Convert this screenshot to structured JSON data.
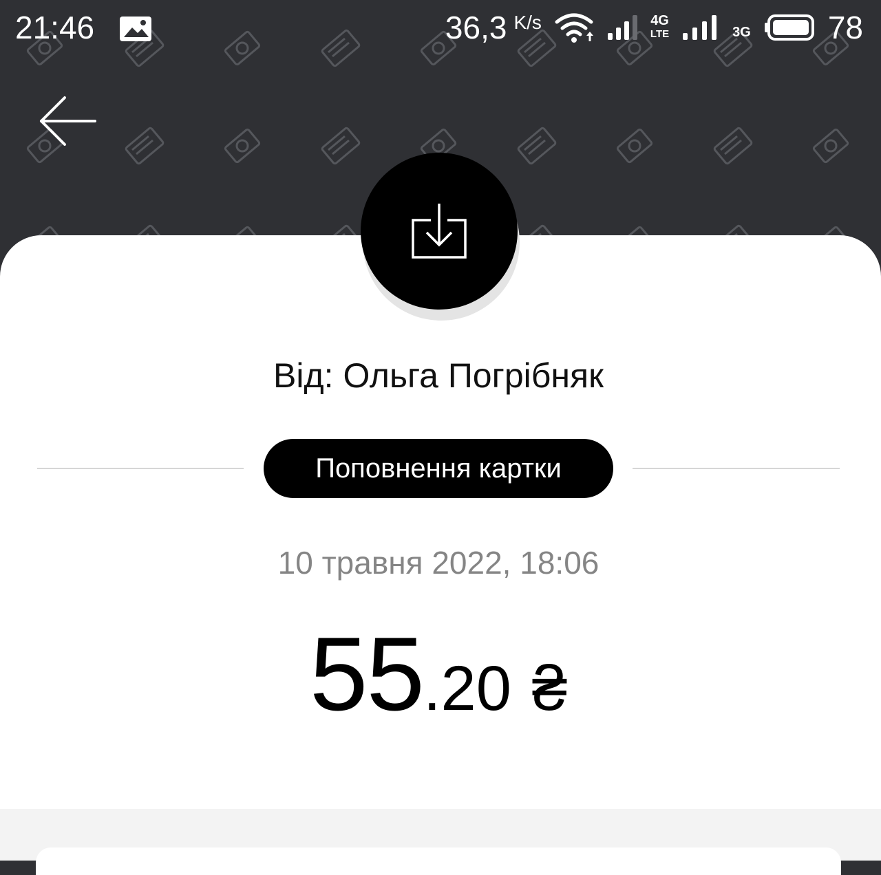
{
  "status_bar": {
    "time": "21:46",
    "speed": "36,3",
    "speed_unit": "K/s",
    "net_4g": "4G",
    "net_lte": "LTE",
    "net_3g": "3G",
    "battery": "78"
  },
  "transaction": {
    "sender": "Від: Ольга Погрібняк",
    "type": "Поповнення картки",
    "datetime": "10 травня 2022, 18:06",
    "amount_int": "55",
    "amount_frac": ".20",
    "currency": "₴"
  },
  "colors": {
    "header_bg": "#2f3034",
    "card_bg": "#ffffff",
    "accent": "#000000",
    "muted_text": "#858585"
  }
}
